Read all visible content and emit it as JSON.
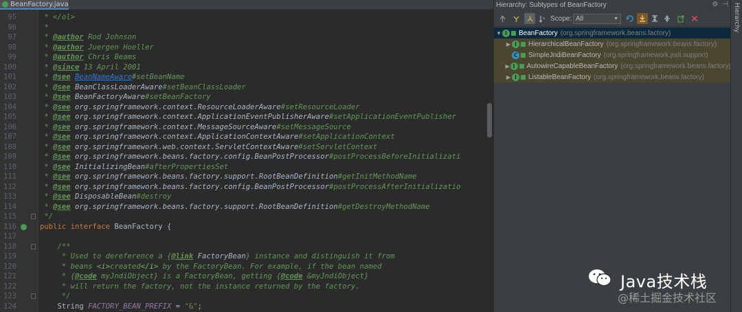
{
  "editor": {
    "tab": {
      "label": "BeanFactory.java",
      "icon": "java-interface-icon"
    },
    "line_numbers": [
      "95",
      "96",
      "97",
      "98",
      "99",
      "100",
      "101",
      "102",
      "103",
      "104",
      "105",
      "106",
      "107",
      "108",
      "109",
      "110",
      "111",
      "112",
      "113",
      "114",
      "115",
      "116",
      "117",
      "118",
      "119",
      "120",
      "121",
      "122",
      "123",
      "124"
    ],
    "lines": [
      [
        {
          "t": " * </ol>",
          "c": "doc"
        }
      ],
      [
        {
          "t": " *",
          "c": "doc"
        }
      ],
      [
        {
          "t": " * ",
          "c": "doc"
        },
        {
          "t": "@author",
          "c": "tag"
        },
        {
          "t": " Rod Johnson",
          "c": "doc"
        }
      ],
      [
        {
          "t": " * ",
          "c": "doc"
        },
        {
          "t": "@author",
          "c": "tag"
        },
        {
          "t": " Juergen Hoeller",
          "c": "doc"
        }
      ],
      [
        {
          "t": " * ",
          "c": "doc"
        },
        {
          "t": "@author",
          "c": "tag"
        },
        {
          "t": " Chris Beams",
          "c": "doc"
        }
      ],
      [
        {
          "t": " * ",
          "c": "doc"
        },
        {
          "t": "@since",
          "c": "tag"
        },
        {
          "t": " 13 April 2001",
          "c": "doc"
        }
      ],
      [
        {
          "t": " * ",
          "c": "doc"
        },
        {
          "t": "@see",
          "c": "tag"
        },
        {
          "t": " ",
          "c": "doc"
        },
        {
          "t": "BeanNameAware",
          "c": "link"
        },
        {
          "t": "#setBeanName",
          "c": "doc"
        }
      ],
      [
        {
          "t": " * ",
          "c": "doc"
        },
        {
          "t": "@see",
          "c": "tag"
        },
        {
          "t": " ",
          "c": "doc"
        },
        {
          "t": "BeanClassLoaderAware",
          "c": "ref"
        },
        {
          "t": "#setBeanClassLoader",
          "c": "doc"
        }
      ],
      [
        {
          "t": " * ",
          "c": "doc"
        },
        {
          "t": "@see",
          "c": "tag"
        },
        {
          "t": " ",
          "c": "doc"
        },
        {
          "t": "BeanFactoryAware",
          "c": "ref"
        },
        {
          "t": "#setBeanFactory",
          "c": "doc"
        }
      ],
      [
        {
          "t": " * ",
          "c": "doc"
        },
        {
          "t": "@see",
          "c": "tag"
        },
        {
          "t": " ",
          "c": "doc"
        },
        {
          "t": "org.springframework.context.ResourceLoaderAware",
          "c": "ref"
        },
        {
          "t": "#setResourceLoader",
          "c": "doc"
        }
      ],
      [
        {
          "t": " * ",
          "c": "doc"
        },
        {
          "t": "@see",
          "c": "tag"
        },
        {
          "t": " ",
          "c": "doc"
        },
        {
          "t": "org.springframework.context.ApplicationEventPublisherAware",
          "c": "ref"
        },
        {
          "t": "#setApplicationEventPublisher",
          "c": "doc"
        }
      ],
      [
        {
          "t": " * ",
          "c": "doc"
        },
        {
          "t": "@see",
          "c": "tag"
        },
        {
          "t": " ",
          "c": "doc"
        },
        {
          "t": "org.springframework.context.MessageSourceAware",
          "c": "ref"
        },
        {
          "t": "#setMessageSource",
          "c": "doc"
        }
      ],
      [
        {
          "t": " * ",
          "c": "doc"
        },
        {
          "t": "@see",
          "c": "tag"
        },
        {
          "t": " ",
          "c": "doc"
        },
        {
          "t": "org.springframework.context.ApplicationContextAware",
          "c": "ref"
        },
        {
          "t": "#setApplicationContext",
          "c": "doc"
        }
      ],
      [
        {
          "t": " * ",
          "c": "doc"
        },
        {
          "t": "@see",
          "c": "tag"
        },
        {
          "t": " ",
          "c": "doc"
        },
        {
          "t": "org.springframework.web.context.ServletContextAware",
          "c": "ref"
        },
        {
          "t": "#setServletContext",
          "c": "doc"
        }
      ],
      [
        {
          "t": " * ",
          "c": "doc"
        },
        {
          "t": "@see",
          "c": "tag"
        },
        {
          "t": " ",
          "c": "doc"
        },
        {
          "t": "org.springframework.beans.factory.config.BeanPostProcessor",
          "c": "ref"
        },
        {
          "t": "#postProcessBeforeInitializati",
          "c": "doc"
        }
      ],
      [
        {
          "t": " * ",
          "c": "doc"
        },
        {
          "t": "@see",
          "c": "tag"
        },
        {
          "t": " ",
          "c": "doc"
        },
        {
          "t": "InitializingBean",
          "c": "ref"
        },
        {
          "t": "#afterPropertiesSet",
          "c": "doc"
        }
      ],
      [
        {
          "t": " * ",
          "c": "doc"
        },
        {
          "t": "@see",
          "c": "tag"
        },
        {
          "t": " ",
          "c": "doc"
        },
        {
          "t": "org.springframework.beans.factory.support.RootBeanDefinition",
          "c": "ref"
        },
        {
          "t": "#getInitMethodName",
          "c": "doc"
        }
      ],
      [
        {
          "t": " * ",
          "c": "doc"
        },
        {
          "t": "@see",
          "c": "tag"
        },
        {
          "t": " ",
          "c": "doc"
        },
        {
          "t": "org.springframework.beans.factory.config.BeanPostProcessor",
          "c": "ref"
        },
        {
          "t": "#postProcessAfterInitializatio",
          "c": "doc"
        }
      ],
      [
        {
          "t": " * ",
          "c": "doc"
        },
        {
          "t": "@see",
          "c": "tag"
        },
        {
          "t": " ",
          "c": "doc"
        },
        {
          "t": "DisposableBean",
          "c": "ref"
        },
        {
          "t": "#destroy",
          "c": "doc"
        }
      ],
      [
        {
          "t": " * ",
          "c": "doc"
        },
        {
          "t": "@see",
          "c": "tag"
        },
        {
          "t": " ",
          "c": "doc"
        },
        {
          "t": "org.springframework.beans.factory.support.RootBeanDefinition",
          "c": "ref"
        },
        {
          "t": "#getDestroyMethodName",
          "c": "doc"
        }
      ],
      [
        {
          "t": " */",
          "c": "doc"
        }
      ],
      [
        {
          "t": "public interface ",
          "c": "kw"
        },
        {
          "t": "BeanFactory {",
          "c": "plain"
        }
      ],
      [],
      [
        {
          "t": "    /**",
          "c": "doc"
        }
      ],
      [
        {
          "t": "     * Used to dereference a {",
          "c": "doc"
        },
        {
          "t": "@link",
          "c": "tag"
        },
        {
          "t": " ",
          "c": "doc"
        },
        {
          "t": "FactoryBean",
          "c": "ref"
        },
        {
          "t": "} instance and distinguish it from",
          "c": "doc"
        }
      ],
      [
        {
          "t": "     * beans ",
          "c": "doc"
        },
        {
          "t": "<i>",
          "c": "htmltag"
        },
        {
          "t": "created",
          "c": "doc"
        },
        {
          "t": "</i>",
          "c": "htmltag"
        },
        {
          "t": " by the FactoryBean. For example, if the bean named",
          "c": "doc"
        }
      ],
      [
        {
          "t": "     * {",
          "c": "doc"
        },
        {
          "t": "@code",
          "c": "tag"
        },
        {
          "t": " myJndiObject} is a FactoryBean, getting {",
          "c": "doc"
        },
        {
          "t": "@code",
          "c": "tag"
        },
        {
          "t": " &myJndiObject}",
          "c": "doc"
        }
      ],
      [
        {
          "t": "     * will return the factory, not the instance returned by the factory.",
          "c": "doc"
        }
      ],
      [
        {
          "t": "     */",
          "c": "doc"
        }
      ],
      [
        {
          "t": "    String ",
          "c": "plain"
        },
        {
          "t": "FACTORY_BEAN_PREFIX",
          "c": "const"
        },
        {
          "t": " = ",
          "c": "plain"
        },
        {
          "t": "\"&\"",
          "c": "str"
        },
        {
          "t": ";",
          "c": "plain"
        }
      ]
    ]
  },
  "hierarchy": {
    "title": "Hierarchy: Subtypes of BeanFactory",
    "header_icons": [
      "gear-icon",
      "minimize-icon"
    ],
    "scope_label": "Scope:",
    "scope_value": "All",
    "side_tab_label": "Hierarchy",
    "tree": [
      {
        "name": "BeanFactory",
        "pkg": "(org.springframework.beans.factory)",
        "kind": "interface",
        "level": 0,
        "expanded": true,
        "selected": true
      },
      {
        "name": "HierarchicalBeanFactory",
        "pkg": "(org.springframework.beans.factory)",
        "kind": "interface",
        "level": 1,
        "expanded": false,
        "selected": false
      },
      {
        "name": "SimpleJndiBeanFactory",
        "pkg": "(org.springframework.jndi.support)",
        "kind": "class",
        "level": 1,
        "expanded": null,
        "selected": false
      },
      {
        "name": "AutowireCapableBeanFactory",
        "pkg": "(org.springframework.beans.factory)",
        "kind": "interface",
        "level": 1,
        "expanded": false,
        "selected": false
      },
      {
        "name": "ListableBeanFactory",
        "pkg": "(org.springframework.beans.factory)",
        "kind": "interface",
        "level": 1,
        "expanded": false,
        "selected": false
      }
    ]
  },
  "watermark": {
    "title": "Java技术栈",
    "subtitle": "@稀土掘金技术社区"
  },
  "colors": {
    "editor_bg": "#2b2b2b",
    "doc_comment": "#629755",
    "keyword": "#cc7832",
    "selection": "#0d293e"
  }
}
